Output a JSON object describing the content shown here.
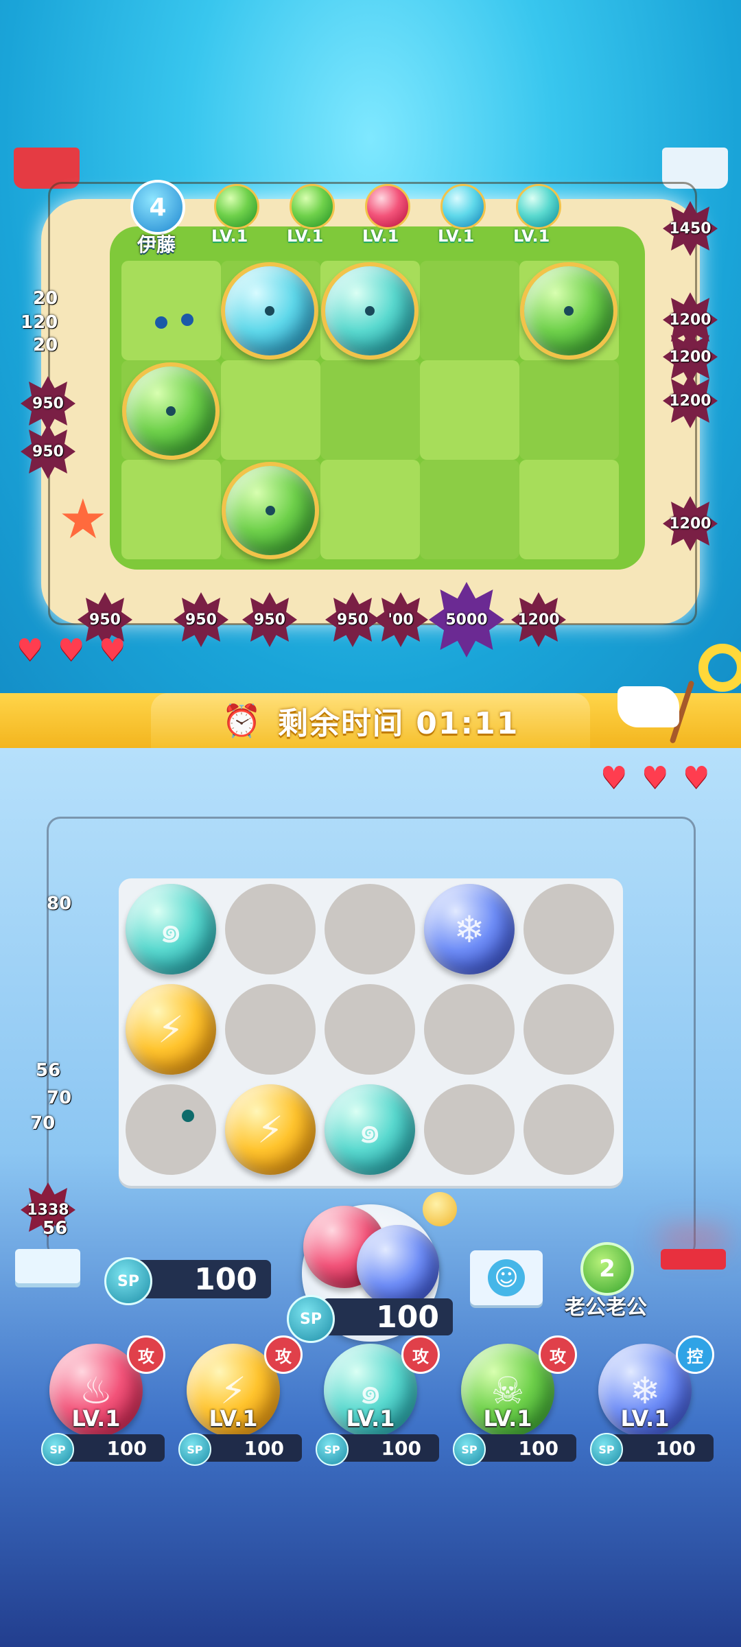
{
  "opponent": {
    "level_badge": "4",
    "name": "伊藤",
    "deck": [
      {
        "label": "LV.1",
        "color": "green"
      },
      {
        "label": "LV.1",
        "color": "green"
      },
      {
        "label": "LV.1",
        "color": "red"
      },
      {
        "label": "LV.1",
        "color": "cyan"
      },
      {
        "label": "LV.1",
        "color": "teal"
      }
    ],
    "hearts": 3,
    "mines_right": [
      "1450",
      "1200",
      "1200",
      "1200",
      "1200"
    ],
    "mines_left": [
      "950",
      "950"
    ],
    "mines_bottom": [
      "950",
      "950",
      "950",
      "950",
      "'00",
      "1200"
    ],
    "boss_hp": "5000",
    "floating_numbers": [
      "120",
      "20",
      "20"
    ]
  },
  "timer": {
    "label": "剩余时间 01:11"
  },
  "player": {
    "hearts": 3,
    "sp_label": "SP",
    "sp_value": "100",
    "summon_cost": "100",
    "partner_level": "2",
    "partner_name": "老公老公",
    "floating_numbers": [
      "80",
      "56",
      "70",
      "70",
      "1338",
      "56"
    ],
    "grid": [
      [
        "teal",
        "empty",
        "empty",
        "blue",
        "empty"
      ],
      [
        "yellow",
        "empty",
        "empty",
        "empty",
        "empty"
      ],
      [
        "empty",
        "yellow",
        "teal",
        "empty",
        "empty"
      ]
    ],
    "cards": [
      {
        "color": "red",
        "tag": "攻",
        "level": "LV.1",
        "cost": "100"
      },
      {
        "color": "yellow",
        "tag": "攻",
        "level": "LV.1",
        "cost": "100"
      },
      {
        "color": "teal",
        "tag": "攻",
        "level": "LV.1",
        "cost": "100"
      },
      {
        "color": "green",
        "tag": "攻",
        "level": "LV.1",
        "cost": "100"
      },
      {
        "color": "blue",
        "tag": "控",
        "level": "LV.1",
        "cost": "100"
      }
    ]
  },
  "icons": {
    "emote": "smile-face-icon",
    "flag": "white-flag-icon",
    "heart": "heart-icon",
    "sp": "sp-coin-icon"
  },
  "colors": {
    "timer_bar": "#f6c02c",
    "panel": "#eef2f6",
    "slot": "#cbc7c3",
    "mine": "#7a1f45",
    "heart": "#ff3d4f"
  }
}
